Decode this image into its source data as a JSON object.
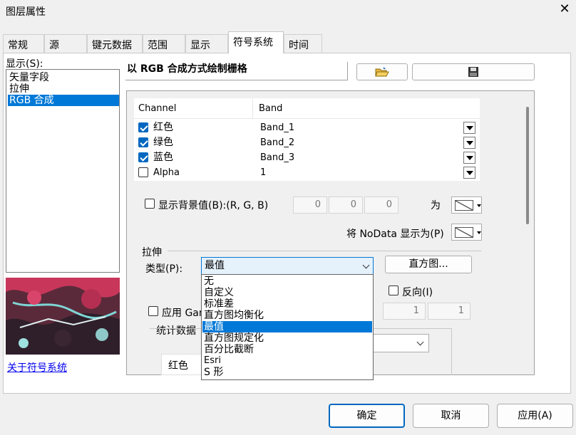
{
  "window": {
    "title": "图层属性",
    "close": "✕"
  },
  "tabs": [
    {
      "label": "常规"
    },
    {
      "label": "源"
    },
    {
      "label": "键元数据"
    },
    {
      "label": "范围"
    },
    {
      "label": "显示"
    },
    {
      "label": "符号系统"
    },
    {
      "label": "时间"
    }
  ],
  "sidebar": {
    "show_label": "显示(S):",
    "items": [
      {
        "label": "矢量字段"
      },
      {
        "label": "拉伸"
      },
      {
        "label": "RGB 合成"
      }
    ],
    "about_link": "关于符号系统"
  },
  "renderer": {
    "title": "以 RGB 合成方式绘制栅格"
  },
  "toolbar": {
    "open_icon": "folder-open-icon",
    "save_icon": "floppy-save-icon"
  },
  "bands": {
    "headers": {
      "channel": "Channel",
      "band": "Band"
    },
    "rows": [
      {
        "channel": "红色",
        "band": "Band_1",
        "checked": true
      },
      {
        "channel": "绿色",
        "band": "Band_2",
        "checked": true
      },
      {
        "channel": "蓝色",
        "band": "Band_3",
        "checked": true
      },
      {
        "channel": "Alpha",
        "band": "1",
        "checked": false
      }
    ]
  },
  "background": {
    "label": "显示背景值(B):(R, G, B)",
    "values": [
      "0",
      "0",
      "0"
    ],
    "as_label": "为"
  },
  "nodata": {
    "label": "将 NoData 显示为(P)"
  },
  "stretch": {
    "group_label": "拉伸",
    "type_label": "类型(P):",
    "type_value": "最值",
    "histogram_button": "直方图...",
    "invert_label": "反向(I)",
    "gamma_label": "应用 Gam",
    "gamma_values": [
      "1",
      "1"
    ],
    "stats_label": "统计数据",
    "stats_row_first": "红色",
    "options": [
      "无",
      "自定义",
      "标准差",
      "直方图均衡化",
      "最值",
      "直方图规定化",
      "百分比截断",
      "Esri",
      "S 形"
    ],
    "selected_index": 4
  },
  "footer": {
    "ok": "确定",
    "cancel": "取消",
    "apply": "应用(A)"
  }
}
